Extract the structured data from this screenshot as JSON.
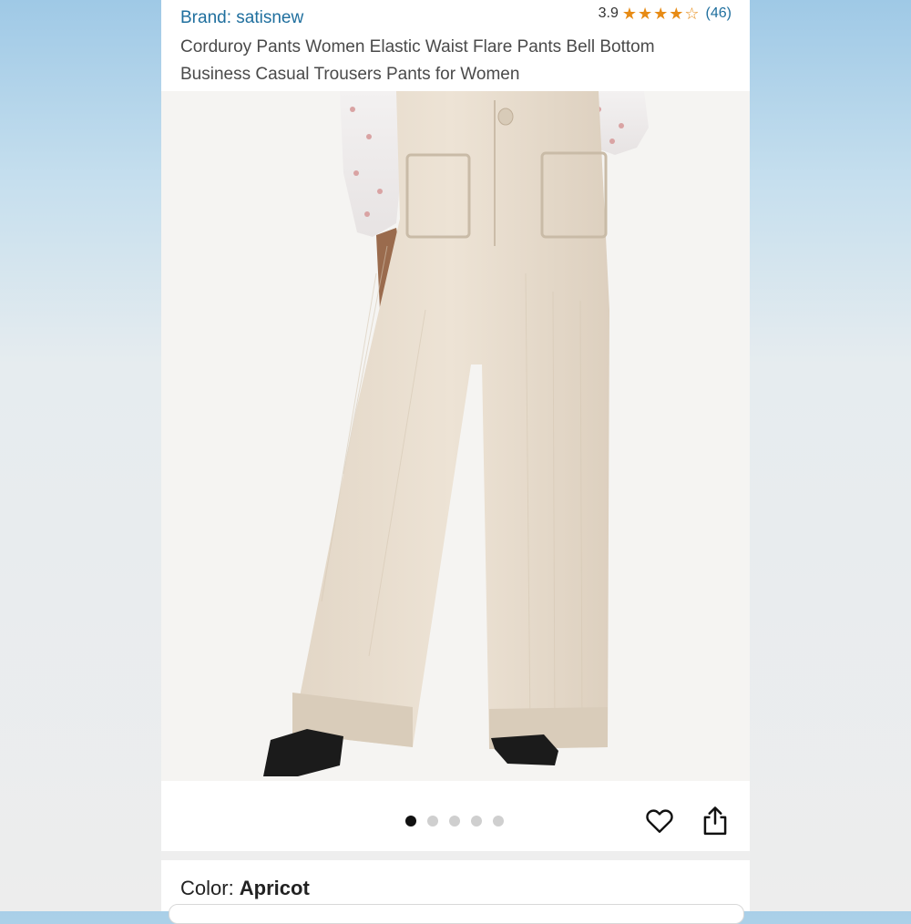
{
  "product": {
    "brand": "Brand: satisnew",
    "rating": "3.9",
    "stars": 3.9,
    "review_count": "(46)",
    "title": "Corduroy Pants Women Elastic Waist Flare Pants Bell Bottom Business Casual Trousers Pants for Women"
  },
  "gallery": {
    "image_count": 5,
    "active_index": 0
  },
  "actions": {
    "heart_icon": "heart-icon",
    "share_icon": "share-icon"
  },
  "color": {
    "label": "Color: ",
    "value": "Apricot"
  },
  "colors": {
    "accent": "#e78b15",
    "link": "#1f6f9e"
  }
}
